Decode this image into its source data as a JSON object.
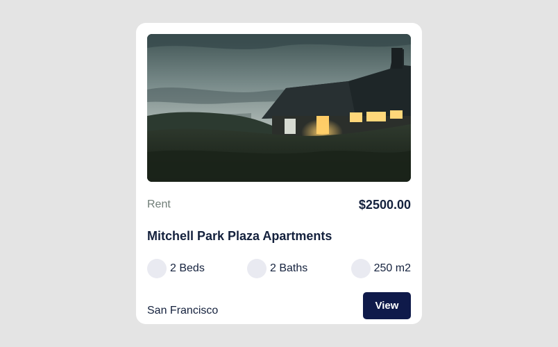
{
  "listing": {
    "type_label": "Rent",
    "price": "$2500.00",
    "title": "Mitchell Park Plaza Apartments",
    "features": {
      "beds": "2 Beds",
      "baths": "2 Baths",
      "area": "250 m2"
    },
    "city": "San Francisco",
    "view_label": "View"
  }
}
